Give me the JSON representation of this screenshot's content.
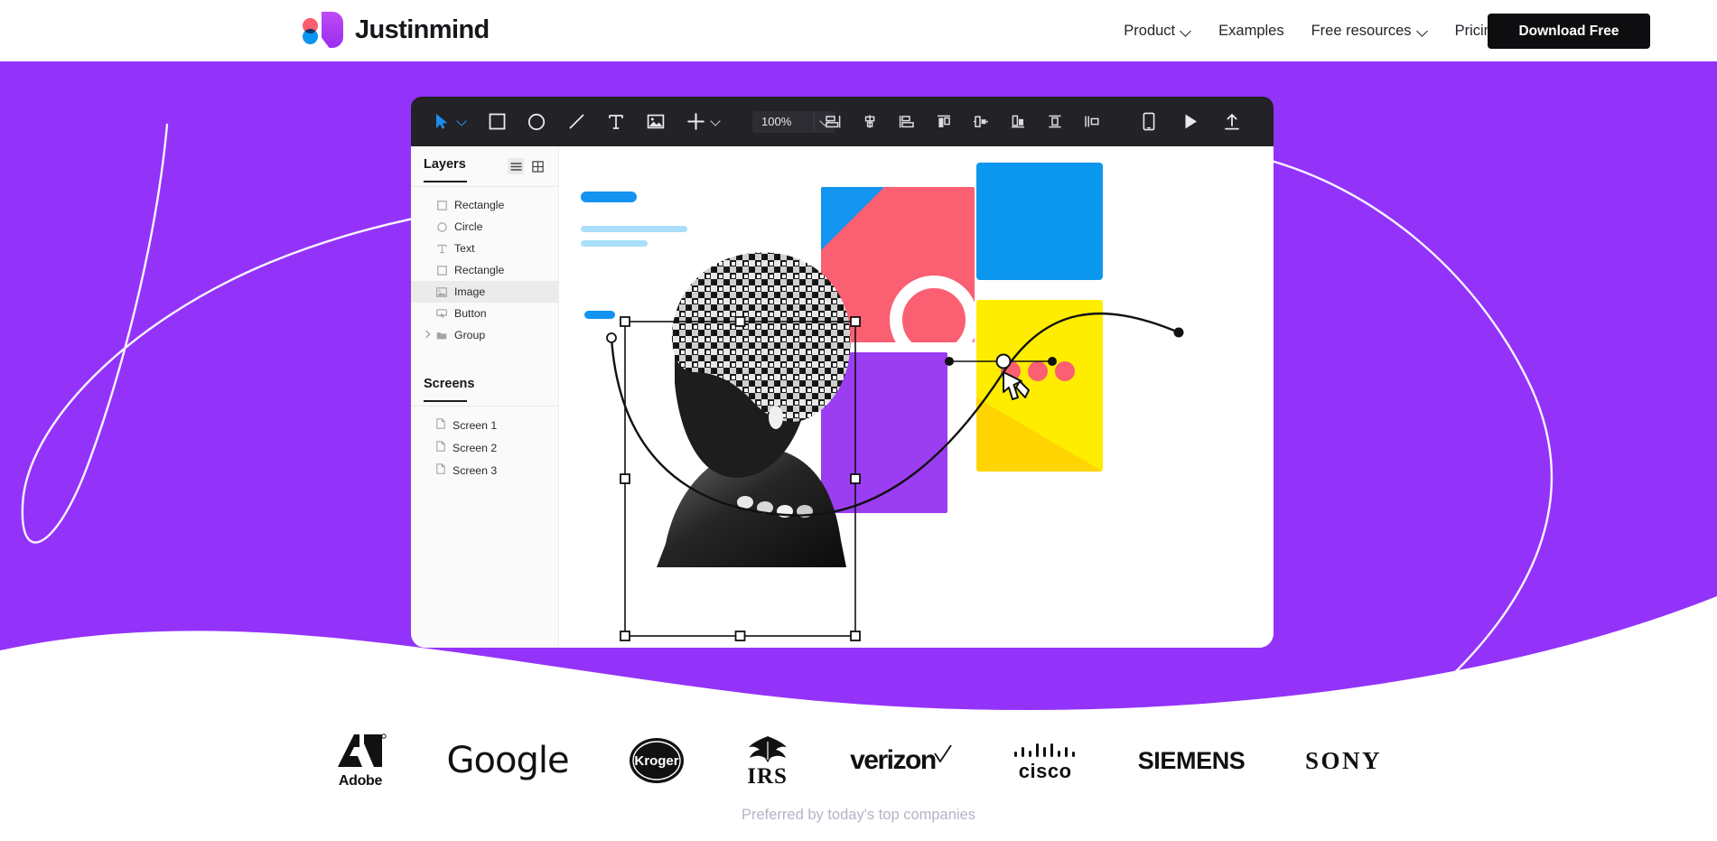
{
  "nav": {
    "brand": "Justinmind",
    "links": [
      {
        "label": "Product",
        "has_dropdown": true
      },
      {
        "label": "Examples",
        "has_dropdown": false
      },
      {
        "label": "Free resources",
        "has_dropdown": true
      },
      {
        "label": "Pricing",
        "has_dropdown": false
      }
    ],
    "cta_label": "Download Free"
  },
  "app": {
    "toolbar": {
      "zoom_value": "100%",
      "left_tools": [
        "cursor-tool",
        "rectangle-tool",
        "ellipse-tool",
        "line-tool",
        "text-tool",
        "image-tool",
        "add-tool"
      ],
      "align_tools": [
        "align-left",
        "align-center-horizontal",
        "align-right",
        "align-top",
        "distribute-horizontal",
        "align-bottom",
        "align-middle-vertical",
        "distribute-vertical"
      ],
      "right_tools": [
        "device-preview",
        "play-preview",
        "share-publish"
      ]
    },
    "layers_panel": {
      "title": "Layers",
      "view_list_icon": "list-view-icon",
      "view_grid_icon": "grid-view-icon",
      "items": [
        {
          "label": "Rectangle",
          "icon": "rectangle-icon",
          "selected": false,
          "expandable": false
        },
        {
          "label": "Circle",
          "icon": "circle-icon",
          "selected": false,
          "expandable": false
        },
        {
          "label": "Text",
          "icon": "text-icon",
          "selected": false,
          "expandable": false
        },
        {
          "label": "Rectangle",
          "icon": "rectangle-icon",
          "selected": false,
          "expandable": false
        },
        {
          "label": "Image",
          "icon": "image-icon",
          "selected": true,
          "expandable": false
        },
        {
          "label": "Button",
          "icon": "button-icon",
          "selected": false,
          "expandable": false
        },
        {
          "label": "Group",
          "icon": "folder-icon",
          "selected": false,
          "expandable": true
        }
      ]
    },
    "screens_panel": {
      "title": "Screens",
      "items": [
        {
          "label": "Screen 1",
          "icon": "page-icon"
        },
        {
          "label": "Screen 2",
          "icon": "page-icon"
        },
        {
          "label": "Screen 3",
          "icon": "page-icon"
        }
      ]
    },
    "canvas": {
      "cursor": "pen-tool-cursor",
      "shapes": [
        {
          "name": "blue-pill-top",
          "color": "#1294f0"
        },
        {
          "name": "light-bar-1",
          "color": "#aadff9"
        },
        {
          "name": "light-bar-2",
          "color": "#aadff9"
        },
        {
          "name": "blue-pill-small",
          "color": "#1294f0"
        },
        {
          "name": "pink-card",
          "color": "#fb5f72"
        },
        {
          "name": "pink-card-corner",
          "color": "#1294f0"
        },
        {
          "name": "purple-card",
          "color": "#9b3ef2"
        },
        {
          "name": "blue-card",
          "color": "#0c97ef"
        },
        {
          "name": "yellow-card",
          "color": "#ffed00"
        },
        {
          "name": "yellow-card-shadow",
          "color": "#ffd400"
        },
        {
          "name": "pink-dot",
          "color": "#fb5f72"
        }
      ]
    }
  },
  "hero": {
    "bg_color": "#9333fa",
    "decor": [
      "white-loop-curve-left",
      "white-curve-right"
    ]
  },
  "clients": {
    "tagline": "Preferred by today's top companies",
    "logos": [
      {
        "name": "adobe-logo",
        "label": "Adobe"
      },
      {
        "name": "google-logo",
        "label": "Google"
      },
      {
        "name": "kroger-logo",
        "label": "Kroger"
      },
      {
        "name": "irs-logo",
        "label": "IRS"
      },
      {
        "name": "verizon-logo",
        "label": "verizon"
      },
      {
        "name": "cisco-logo",
        "label": "cisco"
      },
      {
        "name": "siemens-logo",
        "label": "SIEMENS"
      },
      {
        "name": "sony-logo",
        "label": "SONY"
      }
    ]
  }
}
